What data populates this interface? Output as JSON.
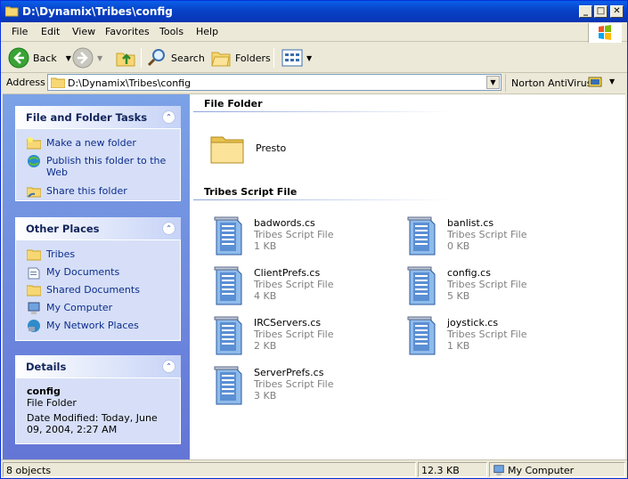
{
  "window": {
    "title": "D:\\Dynamix\\Tribes\\config"
  },
  "menu": [
    "File",
    "Edit",
    "View",
    "Favorites",
    "Tools",
    "Help"
  ],
  "toolbar": {
    "back_label": "Back",
    "search_label": "Search",
    "folders_label": "Folders"
  },
  "address": {
    "label": "Address",
    "value": "D:\\Dynamix\\Tribes\\config",
    "norton_label": "Norton AntiVirus"
  },
  "tasks_panel": {
    "title": "File and Folder Tasks",
    "items": [
      {
        "label": "Make a new folder",
        "icon": "new-folder-icon"
      },
      {
        "label": "Publish this folder to the Web",
        "icon": "publish-web-icon"
      },
      {
        "label": "Share this folder",
        "icon": "share-folder-icon"
      }
    ]
  },
  "places_panel": {
    "title": "Other Places",
    "items": [
      {
        "label": "Tribes",
        "icon": "folder-icon"
      },
      {
        "label": "My Documents",
        "icon": "my-documents-icon"
      },
      {
        "label": "Shared Documents",
        "icon": "shared-documents-icon"
      },
      {
        "label": "My Computer",
        "icon": "my-computer-icon"
      },
      {
        "label": "My Network Places",
        "icon": "network-places-icon"
      }
    ]
  },
  "details_panel": {
    "title": "Details",
    "name": "config",
    "type": "File Folder",
    "modified": "Date Modified: Today, June 09, 2004, 2:27 AM"
  },
  "groups": {
    "folders_header": "File Folder",
    "scripts_header": "Tribes Script File"
  },
  "folders": [
    {
      "name": "Presto"
    }
  ],
  "files": [
    {
      "name": "badwords.cs",
      "type": "Tribes Script File",
      "size": "1 KB"
    },
    {
      "name": "banlist.cs",
      "type": "Tribes Script File",
      "size": "0 KB"
    },
    {
      "name": "ClientPrefs.cs",
      "type": "Tribes Script File",
      "size": "4 KB"
    },
    {
      "name": "config.cs",
      "type": "Tribes Script File",
      "size": "5 KB"
    },
    {
      "name": "IRCServers.cs",
      "type": "Tribes Script File",
      "size": "2 KB"
    },
    {
      "name": "joystick.cs",
      "type": "Tribes Script File",
      "size": "1 KB"
    },
    {
      "name": "ServerPrefs.cs",
      "type": "Tribes Script File",
      "size": "3 KB"
    }
  ],
  "status": {
    "objects": "8 objects",
    "size": "12.3 KB",
    "location": "My Computer"
  }
}
